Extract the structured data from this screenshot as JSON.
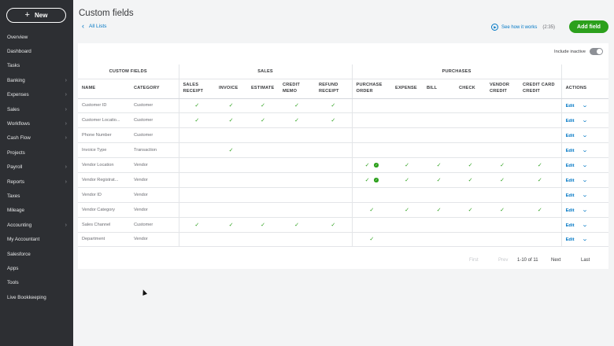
{
  "sidebar": {
    "new_label": "New",
    "items": [
      {
        "label": "Overview",
        "chevron": false
      },
      {
        "label": "Dashboard",
        "chevron": false
      },
      {
        "label": "Tasks",
        "chevron": false
      },
      {
        "label": "Banking",
        "chevron": true
      },
      {
        "label": "Expenses",
        "chevron": true
      },
      {
        "label": "Sales",
        "chevron": true
      },
      {
        "label": "Workflows",
        "chevron": true
      },
      {
        "label": "Cash Flow",
        "chevron": true
      },
      {
        "label": "Projects",
        "chevron": false
      },
      {
        "label": "Payroll",
        "chevron": true
      },
      {
        "label": "Reports",
        "chevron": true
      },
      {
        "label": "Taxes",
        "chevron": false
      },
      {
        "label": "Mileage",
        "chevron": false
      },
      {
        "label": "Accounting",
        "chevron": true
      },
      {
        "label": "My Accountant",
        "chevron": false
      },
      {
        "label": "Salesforce",
        "chevron": false
      },
      {
        "label": "Apps",
        "chevron": false
      },
      {
        "label": "Tools",
        "chevron": false
      },
      {
        "label": "Live Bookkeeping",
        "chevron": false
      }
    ]
  },
  "header": {
    "title": "Custom fields",
    "back_link": "All Lists",
    "how_it_works": "See how it works",
    "how_it_works_duration": "(2:35)",
    "add_field_label": "Add field"
  },
  "table": {
    "include_inactive": "Include inactive",
    "groups": {
      "custom_fields": "CUSTOM FIELDS",
      "sales": "SALES",
      "purchases": "PURCHASES"
    },
    "columns": {
      "name": "NAME",
      "category": "CATEGORY",
      "sales_receipt": "SALES RECEIPT",
      "invoice": "INVOICE",
      "estimate": "ESTIMATE",
      "credit_memo": "CREDIT MEMO",
      "refund_receipt": "REFUND RECEIPT",
      "purchase_order": "PURCHASE ORDER",
      "expense": "EXPENSE",
      "bill": "BILL",
      "check": "CHECK",
      "vendor_credit": "VENDOR CREDIT",
      "credit_card_credit": "CREDIT CARD CREDIT",
      "actions": "ACTIONS"
    },
    "edit_label": "Edit",
    "check_glyph": "✓",
    "rows": [
      {
        "name": "Customer ID",
        "category": "Customer",
        "checks": [
          1,
          1,
          1,
          1,
          1,
          0,
          0,
          0,
          0,
          0,
          0
        ],
        "po_extra": false
      },
      {
        "name": "Customer Locatio...",
        "category": "Customer",
        "checks": [
          1,
          1,
          1,
          1,
          1,
          0,
          0,
          0,
          0,
          0,
          0
        ],
        "po_extra": false
      },
      {
        "name": "Phone Number",
        "category": "Customer",
        "checks": [
          0,
          0,
          0,
          0,
          0,
          0,
          0,
          0,
          0,
          0,
          0
        ],
        "po_extra": false
      },
      {
        "name": "Invoice Type",
        "category": "Transaction",
        "checks": [
          0,
          1,
          0,
          0,
          0,
          0,
          0,
          0,
          0,
          0,
          0
        ],
        "po_extra": false
      },
      {
        "name": "Vendor Location",
        "category": "Vendor",
        "checks": [
          0,
          0,
          0,
          0,
          0,
          1,
          1,
          1,
          1,
          1,
          1
        ],
        "po_extra": true
      },
      {
        "name": "Vendor Registrat...",
        "category": "Vendor",
        "checks": [
          0,
          0,
          0,
          0,
          0,
          1,
          1,
          1,
          1,
          1,
          1
        ],
        "po_extra": true
      },
      {
        "name": "Vendor ID",
        "category": "Vendor",
        "checks": [
          0,
          0,
          0,
          0,
          0,
          0,
          0,
          0,
          0,
          0,
          0
        ],
        "po_extra": false
      },
      {
        "name": "Vendor Category",
        "category": "Vendor",
        "checks": [
          0,
          0,
          0,
          0,
          0,
          1,
          1,
          1,
          1,
          1,
          1
        ],
        "po_extra": false
      },
      {
        "name": "Sales Channel",
        "category": "Customer",
        "checks": [
          1,
          1,
          1,
          1,
          1,
          0,
          0,
          0,
          0,
          0,
          0
        ],
        "po_extra": false
      },
      {
        "name": "Department",
        "category": "Vendor",
        "checks": [
          0,
          0,
          0,
          0,
          0,
          1,
          0,
          0,
          0,
          0,
          0
        ],
        "po_extra": false
      }
    ]
  },
  "pagination": {
    "first": "First",
    "prev": "Prev",
    "range": "1-10 of 11",
    "next": "Next",
    "last": "Last"
  }
}
